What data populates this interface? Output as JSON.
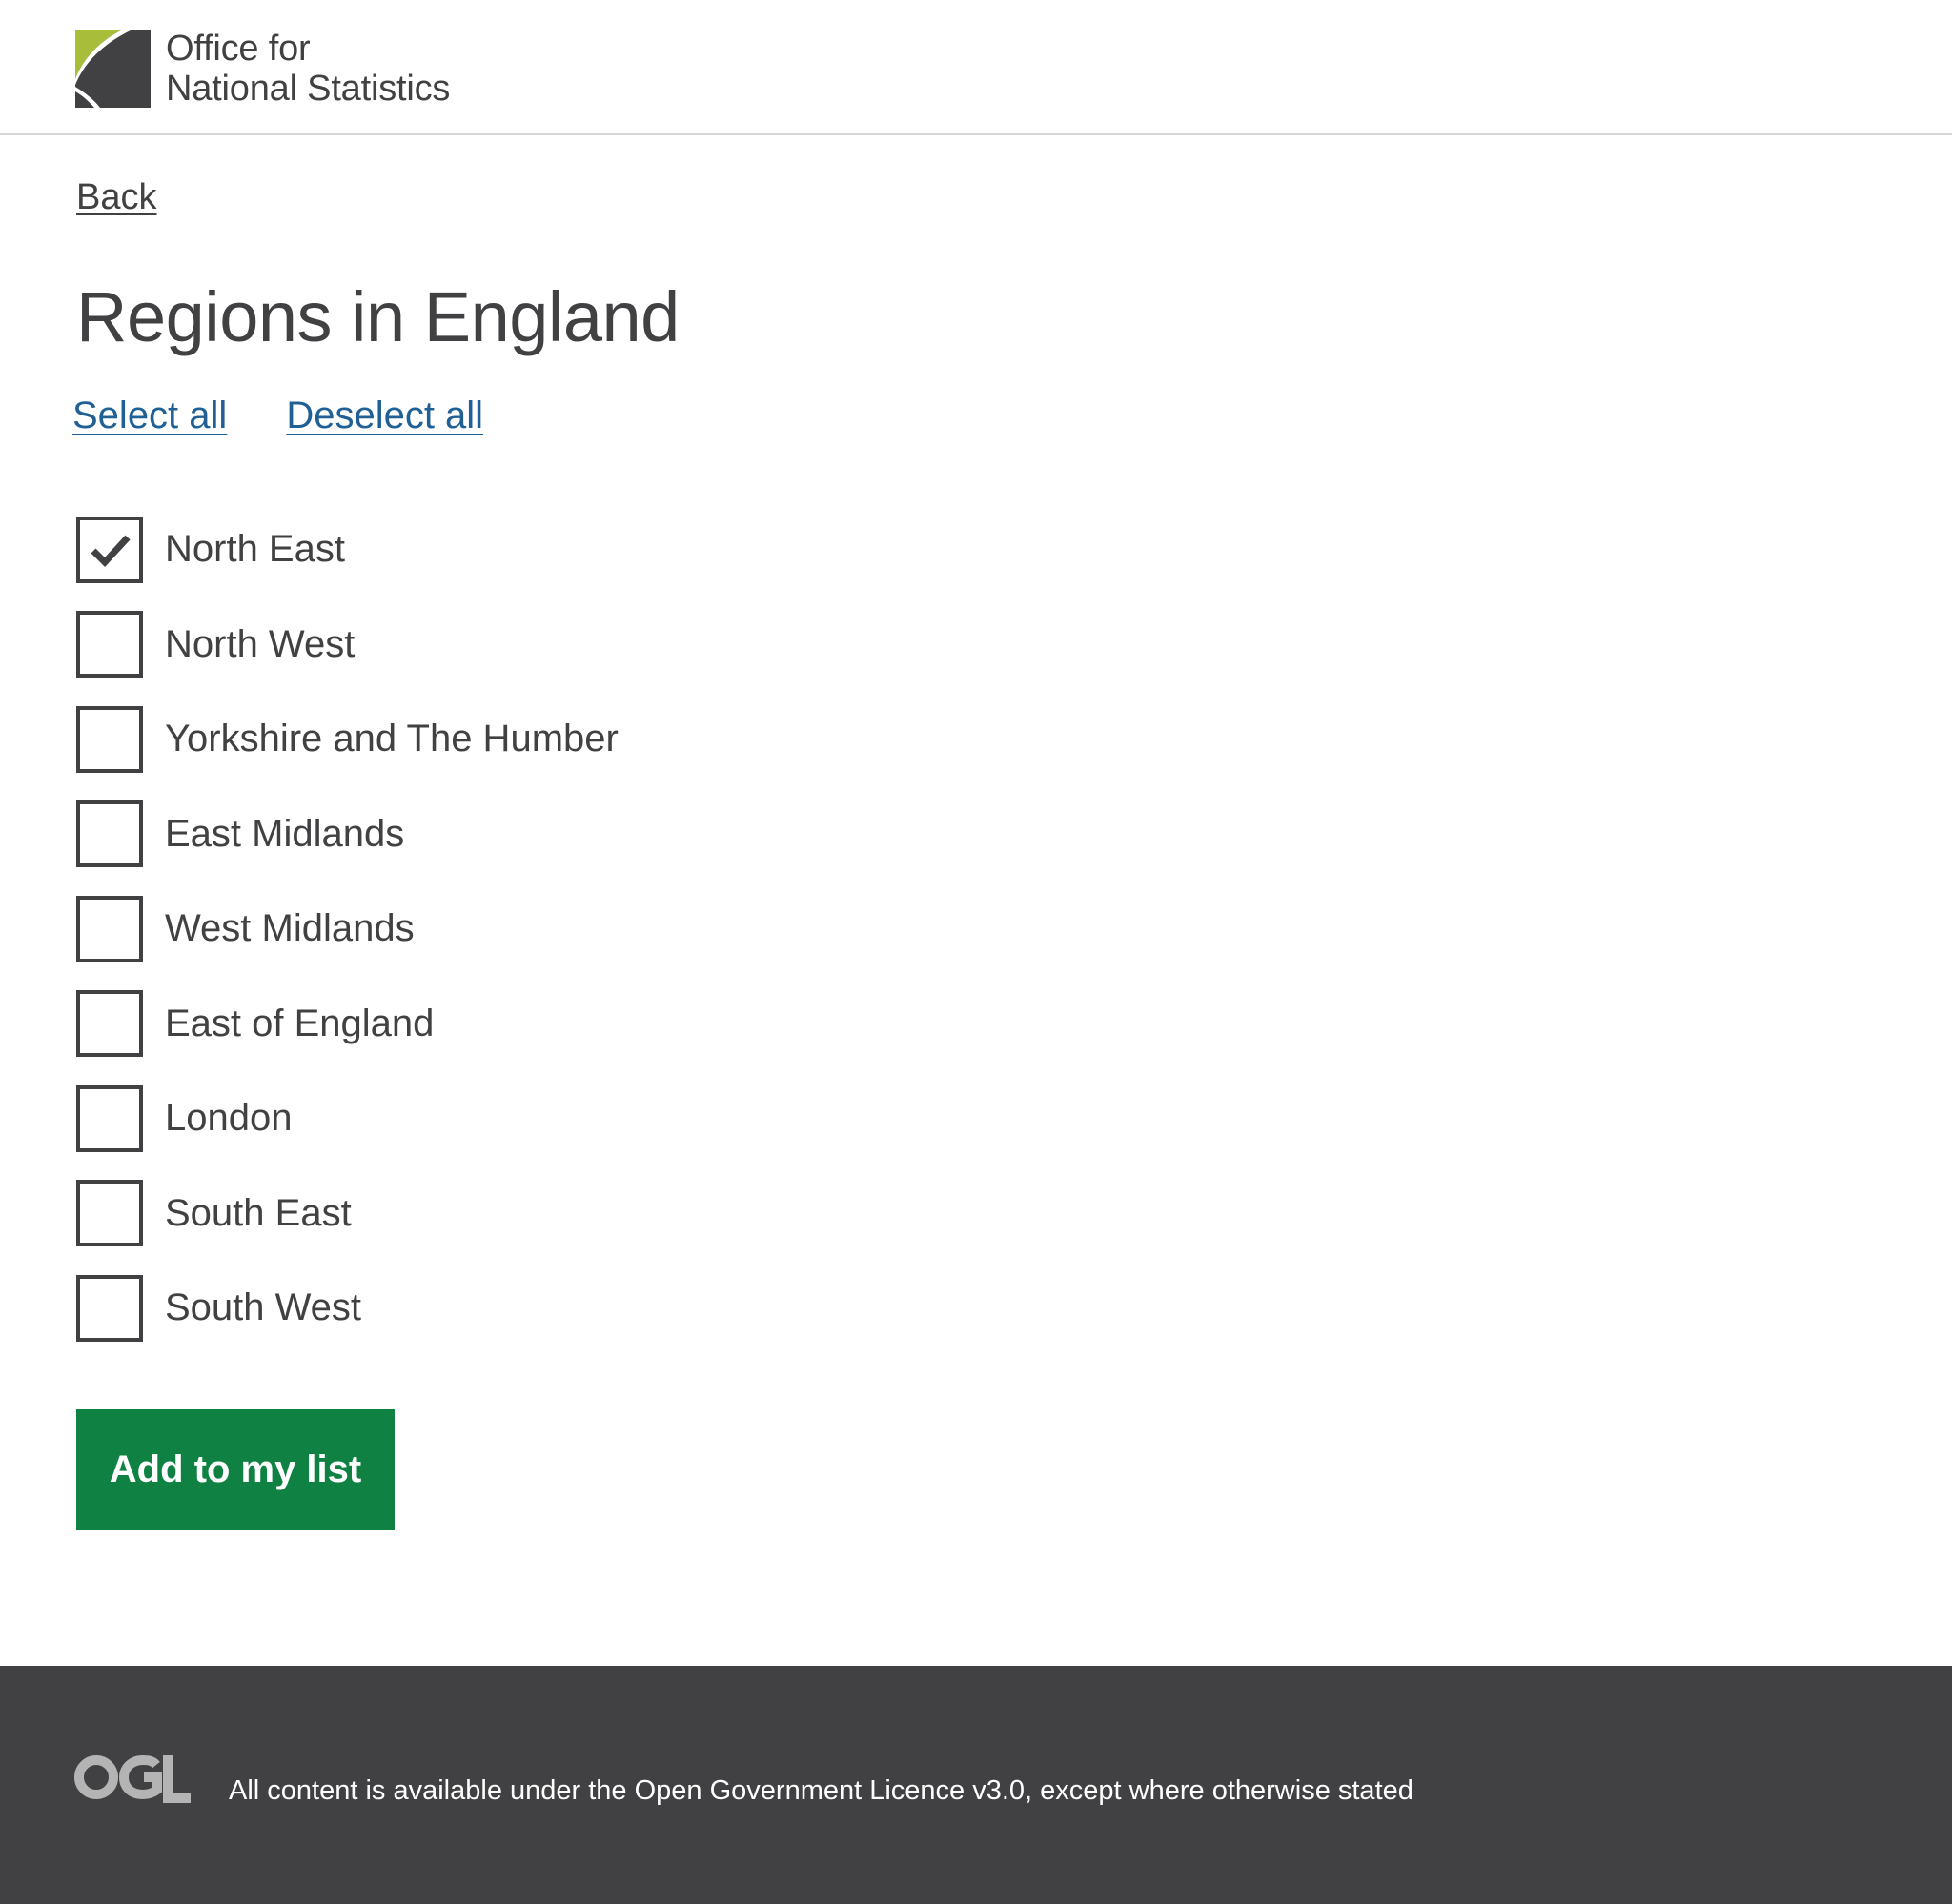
{
  "header": {
    "logo_line1": "Office for",
    "logo_line2": "National Statistics"
  },
  "nav": {
    "back_label": "Back"
  },
  "main": {
    "title": "Regions in England",
    "select_all_label": "Select all",
    "deselect_all_label": "Deselect all",
    "regions": [
      {
        "label": "North East",
        "checked": true
      },
      {
        "label": "North West",
        "checked": false
      },
      {
        "label": "Yorkshire and The Humber",
        "checked": false
      },
      {
        "label": "East Midlands",
        "checked": false
      },
      {
        "label": "West Midlands",
        "checked": false
      },
      {
        "label": "East of England",
        "checked": false
      },
      {
        "label": "London",
        "checked": false
      },
      {
        "label": "South East",
        "checked": false
      },
      {
        "label": "South West",
        "checked": false
      }
    ],
    "add_button_label": "Add to my list"
  },
  "footer": {
    "ogl_logo_text": "OGL",
    "licence_text": "All content is available under the Open Government Licence v3.0, except where otherwise stated"
  },
  "colors": {
    "text": "#414042",
    "link": "#206095",
    "button": "#0f8243",
    "footer_bg": "#414042",
    "logo_green": "#a8bd3a"
  },
  "icons": {
    "logo": "ons-logo-icon",
    "checkmark": "checkmark-icon",
    "ogl": "ogl-logo-icon"
  }
}
